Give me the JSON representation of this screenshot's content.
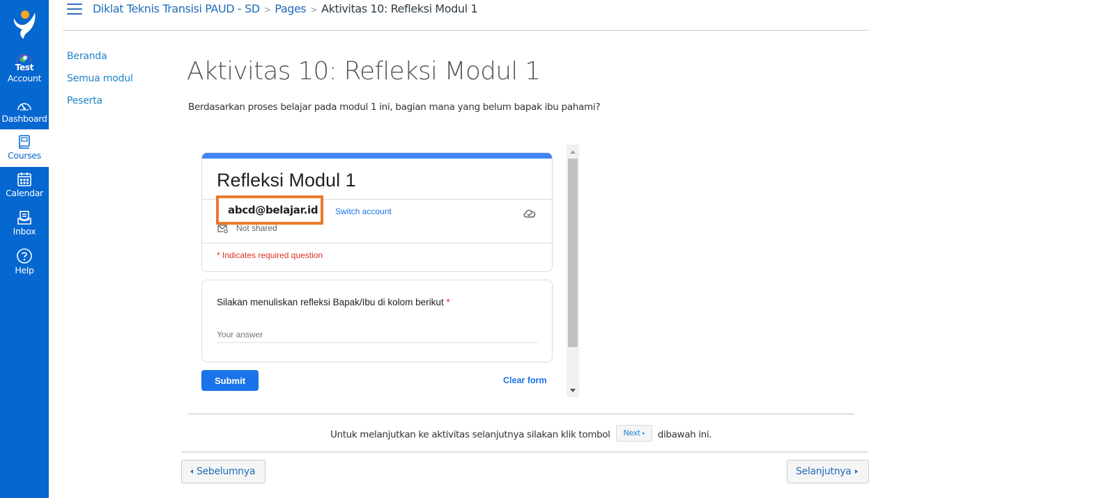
{
  "colors": {
    "nav_bg": "#0567d0",
    "link": "#1f6cb8",
    "form_accent": "#4285f4",
    "form_button": "#1a73e8",
    "required": "#d93025",
    "highlight_box": "#ea7a2c"
  },
  "global_nav": {
    "logo_icon": "brand-logo-icon",
    "items": [
      {
        "label_line1": "Test",
        "label": "Account",
        "icon": "account-avatar-icon",
        "active": false
      },
      {
        "label": "Dashboard",
        "icon": "speedometer-icon",
        "active": false
      },
      {
        "label": "Courses",
        "icon": "book-icon",
        "active": true
      },
      {
        "label": "Calendar",
        "icon": "calendar-icon",
        "active": false
      },
      {
        "label": "Inbox",
        "icon": "inbox-icon",
        "active": false
      },
      {
        "label": "Help",
        "icon": "help-question-icon",
        "active": false
      }
    ]
  },
  "breadcrumb": {
    "menu_icon": "hamburger-icon",
    "items": [
      "Diklat Teknis Transisi PAUD - SD",
      "Pages",
      "Aktivitas 10: Refleksi Modul 1"
    ]
  },
  "course_nav": {
    "items": [
      "Beranda",
      "Semua modul",
      "Peserta"
    ]
  },
  "page": {
    "title": "Aktivitas 10: Refleksi Modul 1",
    "intro": "Berdasarkan proses belajar pada modul 1 ini, bagian mana yang belum bapak ibu pahami?"
  },
  "form": {
    "title": "Refleksi Modul 1",
    "account_email": "abcd@belajar.id",
    "switch_account": "Switch account",
    "not_shared": "Not shared",
    "required_note": "* Indicates required question",
    "question": {
      "label": "Silakan menuliskan refleksi Bapak/Ibu di kolom berikut",
      "required_mark": "*",
      "placeholder": "Your answer",
      "value": ""
    },
    "submit_label": "Submit",
    "clear_label": "Clear form"
  },
  "footer": {
    "continue_before": "Untuk melanjutkan ke aktivitas selanjutnya silakan klik tombol",
    "next_pill": "Next",
    "continue_after": "dibawah ini.",
    "prev_label": "Sebelumnya",
    "next_label": "Selanjutnya"
  }
}
